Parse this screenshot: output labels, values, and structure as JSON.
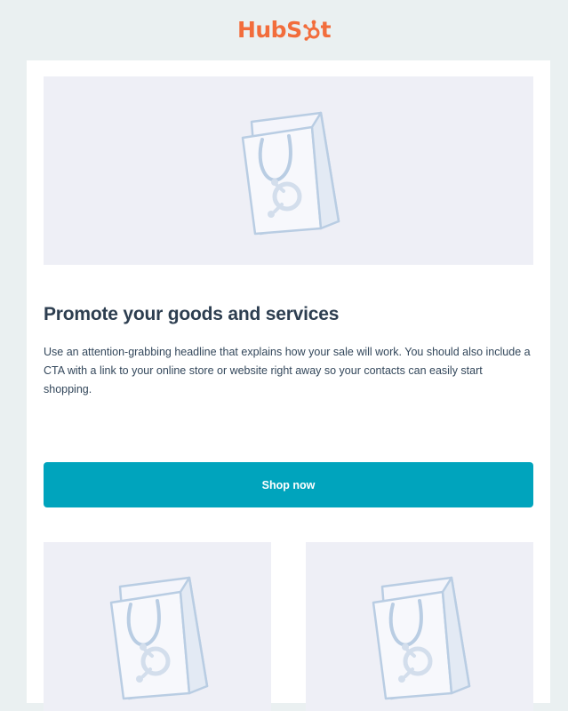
{
  "brand": {
    "logo_text_left": "HubS",
    "logo_text_right": "t",
    "logo_color": "#f26d3c",
    "logo_icon": "sprocket-icon"
  },
  "hero": {
    "image_icon": "shopping-bag-icon"
  },
  "content": {
    "headline": "Promote your goods and services",
    "body": "Use an attention-grabbing headline that explains how your sale will work. You should also include a CTA with a link to your online store or website right away so your contacts can easily start shopping.",
    "cta_label": "Shop now"
  },
  "colors": {
    "background": "#eaf0f1",
    "card": "#ffffff",
    "placeholder": "#eeeff6",
    "headline": "#2d3e50",
    "body_text": "#33475b",
    "cta": "#00a4bd"
  },
  "products": [
    {
      "image_icon": "shopping-bag-icon"
    },
    {
      "image_icon": "shopping-bag-icon"
    }
  ]
}
